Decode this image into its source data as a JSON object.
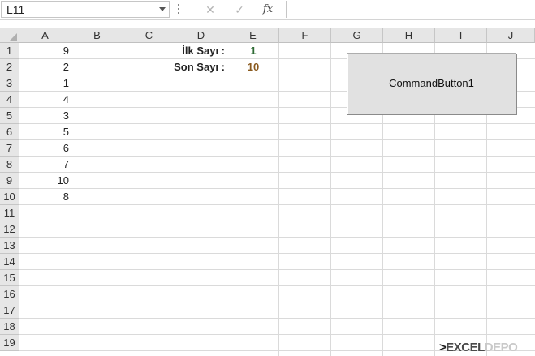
{
  "formula_bar": {
    "name_box": "L11",
    "formula": ""
  },
  "columns": [
    "A",
    "B",
    "C",
    "D",
    "E",
    "F",
    "G",
    "H",
    "I",
    "J"
  ],
  "rows": [
    "1",
    "2",
    "3",
    "4",
    "5",
    "6",
    "7",
    "8",
    "9",
    "10",
    "11",
    "12",
    "13",
    "14",
    "15",
    "16",
    "17",
    "18",
    "19"
  ],
  "column_a_values": [
    "9",
    "2",
    "1",
    "4",
    "3",
    "5",
    "6",
    "7",
    "10",
    "8"
  ],
  "labels": {
    "first": "İlk Sayı :",
    "last": "Son Sayı :"
  },
  "values": {
    "first": "1",
    "last": "10"
  },
  "command_button": "CommandButton1",
  "logo": {
    "part1": "EXCEL",
    "part2": "DEPO"
  }
}
